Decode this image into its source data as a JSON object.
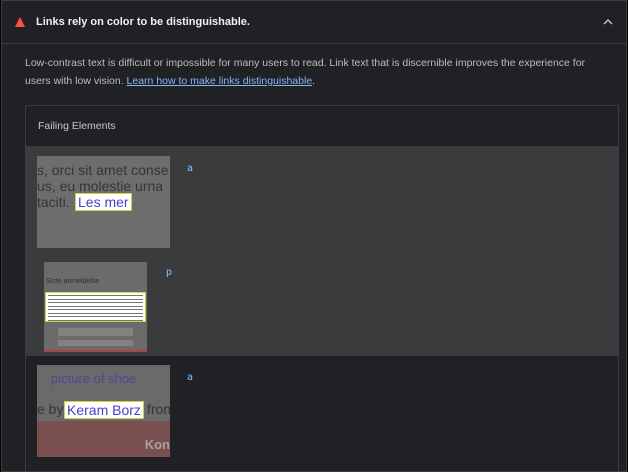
{
  "audit": {
    "title": "Links rely on color to be distinguishable.",
    "status_color": "#ff4e42",
    "description": "Low-contrast text is difficult or impossible for many users to read. Link text that is discernible improves the experience for users with low vision. ",
    "learn_link": "Learn how to make links distinguishable",
    "learn_suffix": "."
  },
  "table": {
    "header": "Failing Elements",
    "rows": [
      {
        "node": "a",
        "thumb_lines": [
          "s, orci sit amet conse",
          "us, eu molestie urna",
          "taciti."
        ],
        "highlight": "Les mer"
      },
      {
        "node": "p",
        "thumb_title": "Siste anmeldelse"
      },
      {
        "node": "a",
        "thumb_pic": "picture of shoe",
        "thumb_prefix": "e by",
        "highlight": "Keram Borz",
        "thumb_suffix": "from",
        "thumb_footer": "Kon"
      }
    ]
  },
  "icons": {
    "status": "fail-triangle-icon",
    "toggle": "chevron-up-icon"
  }
}
